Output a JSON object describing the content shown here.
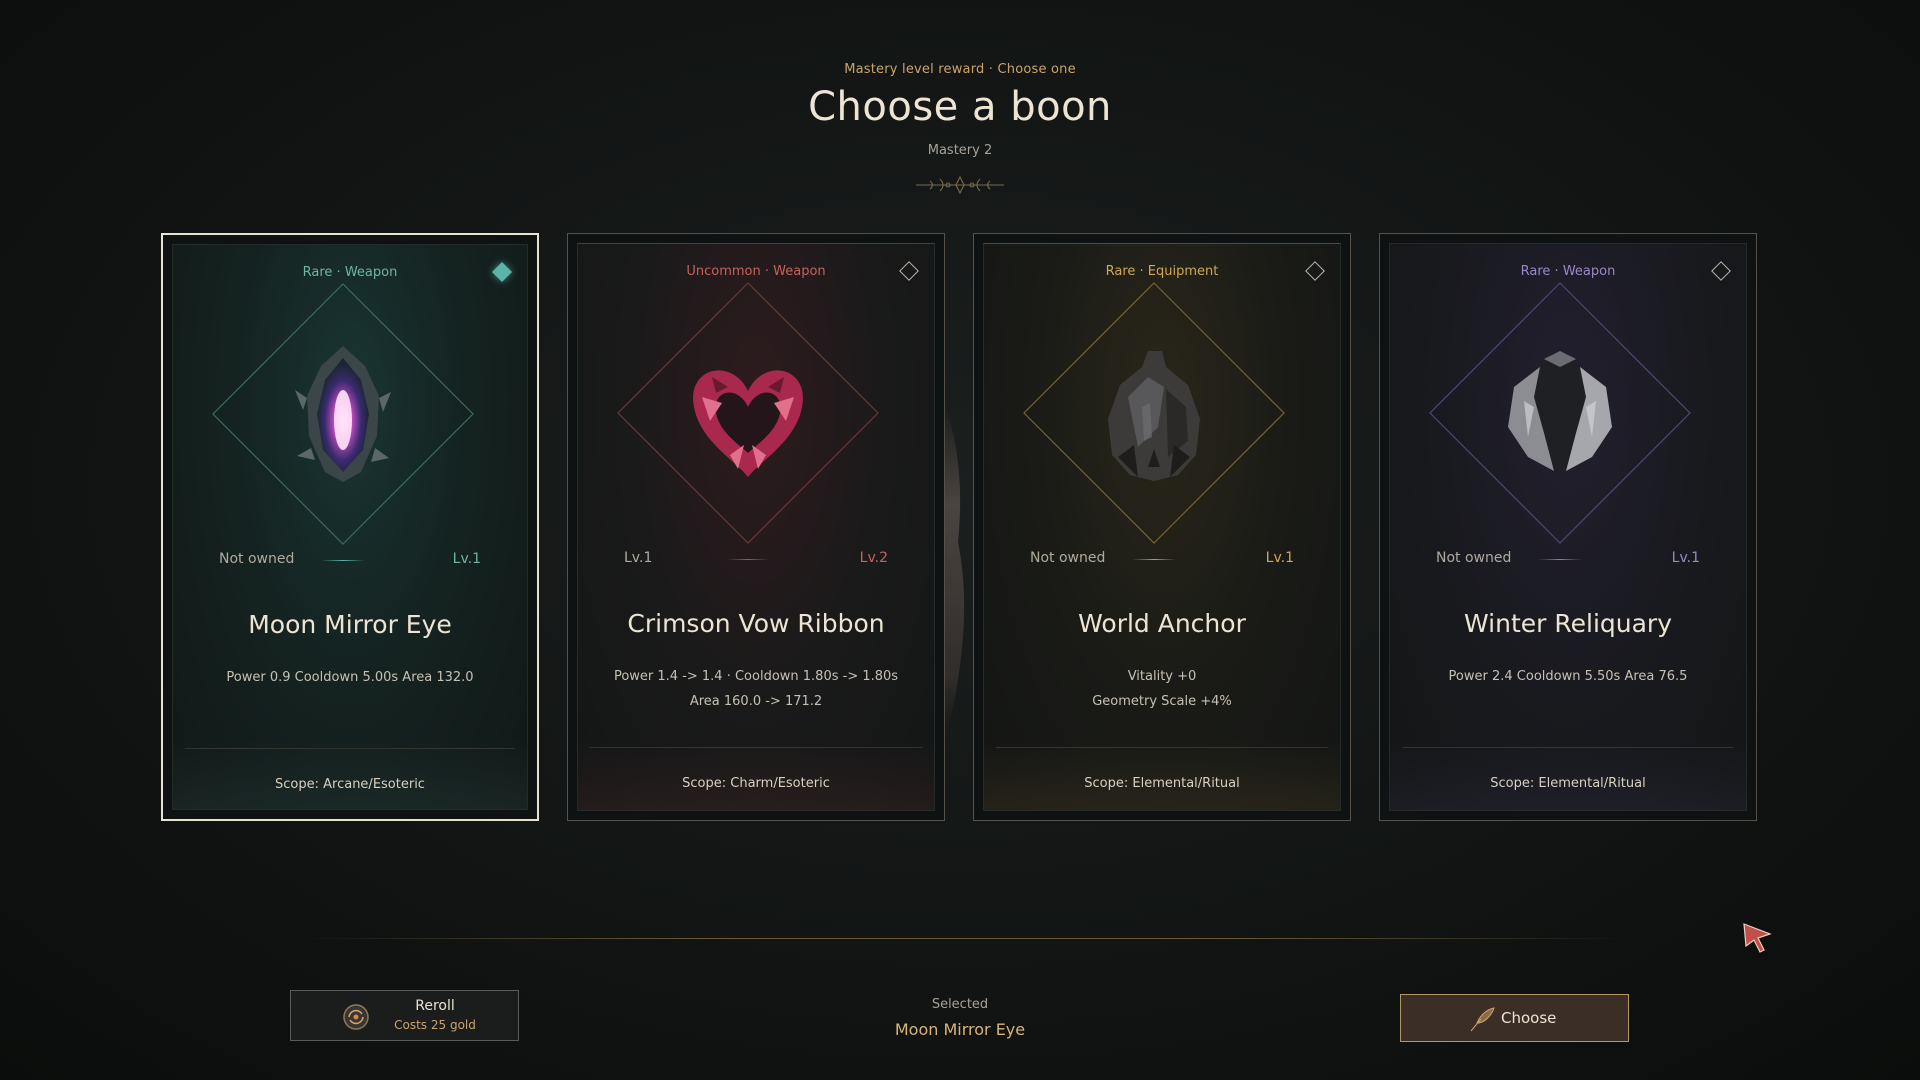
{
  "header": {
    "subtitle": "Mastery level reward · Choose one",
    "title": "Choose a boon",
    "mastery": "Mastery 2"
  },
  "cards": [
    {
      "rarity": "Rare · Weapon",
      "rarity_color": "#6fb3a4",
      "accent": "#5cb3a7",
      "selected": true,
      "art_icon": "moon-mirror-eye-icon",
      "level_left": "Not owned",
      "level_right": "Lv.1",
      "name": "Moon Mirror Eye",
      "stats": [
        "Power 0.9  Cooldown 5.00s  Area 132.0"
      ],
      "scope": "Scope: Arcane/Esoteric"
    },
    {
      "rarity": "Uncommon · Weapon",
      "rarity_color": "#c8615a",
      "accent": "#b2504a",
      "selected": false,
      "art_icon": "crimson-ribbon-icon",
      "level_left": "Lv.1",
      "level_right": "Lv.2",
      "name": "Crimson Vow Ribbon",
      "stats": [
        "Power 1.4 -> 1.4 · Cooldown 1.80s -> 1.80s",
        "Area 160.0 -> 171.2"
      ],
      "scope": "Scope: Charm/Esoteric"
    },
    {
      "rarity": "Rare · Equipment",
      "rarity_color": "#d0a756",
      "accent": "#c49a4c",
      "selected": false,
      "art_icon": "world-anchor-icon",
      "level_left": "Not owned",
      "level_right": "Lv.1",
      "name": "World Anchor",
      "stats": [
        "Vitality +0",
        "Geometry Scale +4%"
      ],
      "scope": "Scope: Elemental/Ritual"
    },
    {
      "rarity": "Rare · Weapon",
      "rarity_color": "#9a88c8",
      "accent": "#8a7cc0",
      "selected": false,
      "art_icon": "winter-reliquary-icon",
      "level_left": "Not owned",
      "level_right": "Lv.1",
      "name": "Winter Reliquary",
      "stats": [
        "Power 2.4  Cooldown 5.50s  Area 76.5"
      ],
      "scope": "Scope: Elemental/Ritual"
    }
  ],
  "footer": {
    "reroll_label": "Reroll",
    "reroll_cost": "Costs 25 gold",
    "selected_label": "Selected",
    "selected_value": "Moon Mirror Eye",
    "choose_label": "Choose"
  }
}
